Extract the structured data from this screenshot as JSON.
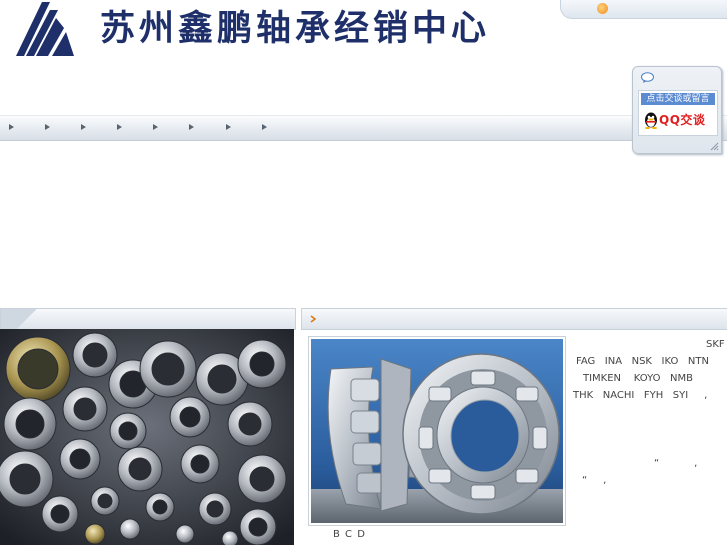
{
  "header": {
    "logo_text": "苏州鑫鹏轴承经销中心"
  },
  "nav": {
    "items": [
      "",
      "",
      "",
      "",
      "",
      "",
      "",
      ""
    ]
  },
  "qq_widget": {
    "link_label": "点击交谈或留言",
    "chat_label": "QQ交谈"
  },
  "intro": {
    "lines": [
      "SKF",
      "FAG   INA   NSK   IKO   NTN",
      "TIMKEN    KOYO   NMB",
      "THK   NACHI   FYH   SYI     ,",
      "“           ,",
      "“     ,"
    ]
  },
  "caption": "B C D",
  "colors": {
    "logo_blue": "#1e2f6a",
    "qq_link_bg": "#5b8bd0",
    "qq_chat_red": "#e02020",
    "topbar_dot": "#f08a1c"
  }
}
